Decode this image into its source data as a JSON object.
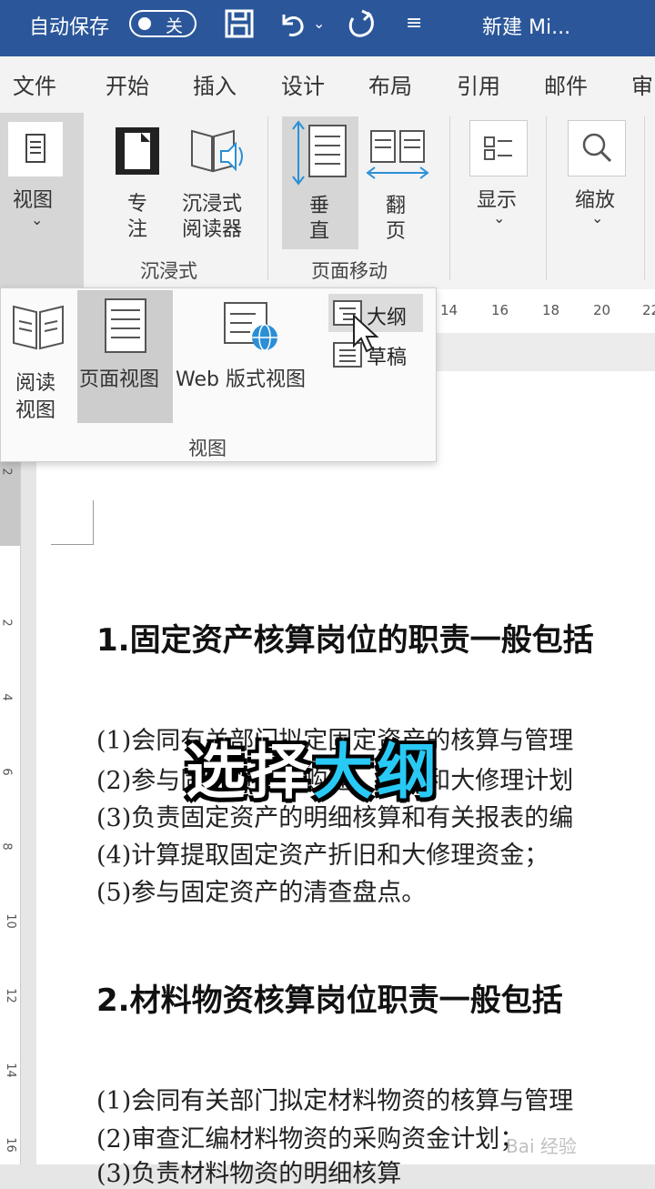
{
  "titlebar": {
    "autosave_label": "自动保存",
    "toggle_state": "关",
    "doc_title": "新建 Mi..."
  },
  "tabs": [
    "文件",
    "开始",
    "插入",
    "设计",
    "布局",
    "引用",
    "邮件",
    "审"
  ],
  "ribbon": {
    "view_btn": "视图",
    "focus_1": "专",
    "focus_2": "注",
    "reader_1": "沉浸式",
    "reader_2": "阅读器",
    "vertical_1": "垂",
    "vertical_2": "直",
    "flip_1": "翻",
    "flip_2": "页",
    "show": "显示",
    "zoom": "缩放",
    "group_immersive": "沉浸式",
    "group_pagemove": "页面移动"
  },
  "ruler_numbers": [
    "14",
    "16",
    "18",
    "20",
    "22"
  ],
  "left_ruler_numbers": [
    "2",
    "2",
    "4",
    "6",
    "8",
    "10",
    "12",
    "14",
    "16"
  ],
  "view_menu": {
    "read_1": "阅读",
    "read_2": "视图",
    "print_layout": "页面视图",
    "web_layout": "Web 版式视图",
    "outline": "大纲",
    "draft": "草稿",
    "group_label": "视图"
  },
  "document": {
    "heading1": "1.固定资产核算岗位的职责一般包括",
    "items1": [
      "(1)会同有关部门拟定固定资产的核算与管理",
      "(2)参与固定资产的购建、改造和大修理计划",
      "(3)负责固定资产的明细核算和有关报表的编",
      "(4)计算提取固定资产折旧和大修理资金；",
      "(5)参与固定资产的清查盘点。"
    ],
    "heading2": "2.材料物资核算岗位职责一般包括",
    "items2": [
      "(1)会同有关部门拟定材料物资的核算与管理",
      "(2)审查汇编材料物资的采购资金计划；",
      "(3)负责材料物资的明细核算"
    ]
  },
  "overlay_caption": {
    "part1": "选择",
    "part2": "大纲"
  },
  "watermark": "Bai 经验"
}
